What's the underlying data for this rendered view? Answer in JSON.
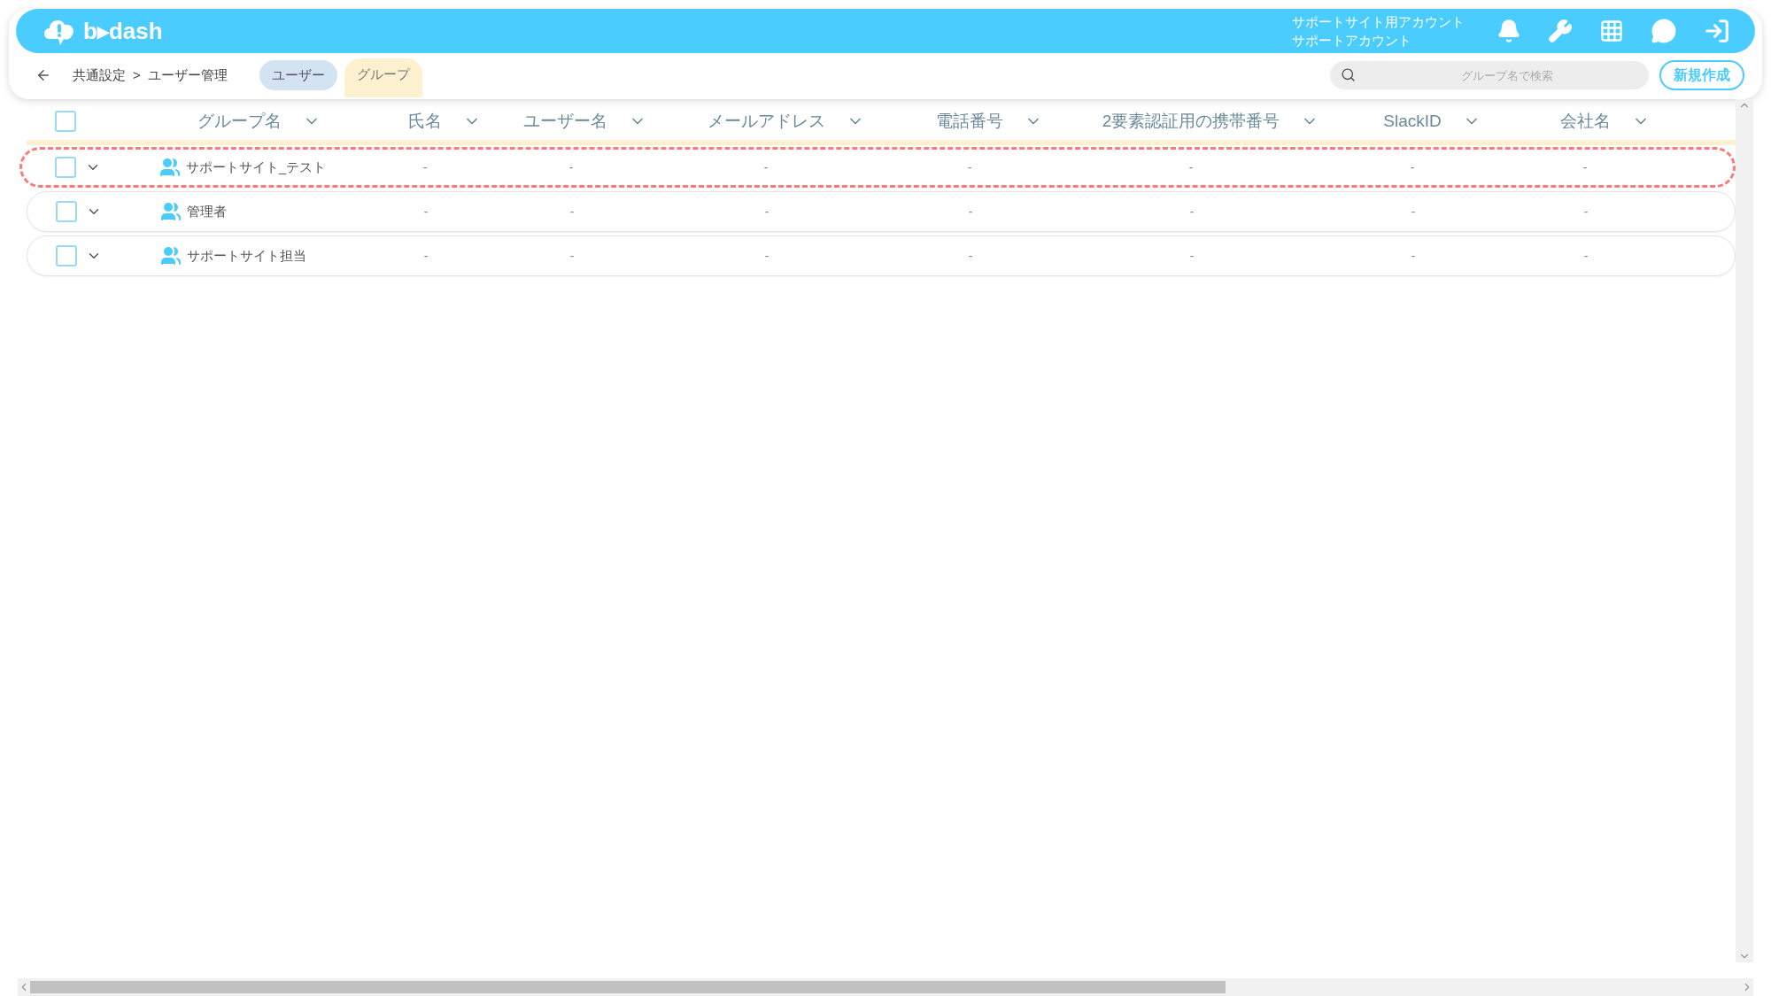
{
  "header": {
    "logo_text": "b▸dash",
    "account_name": "サポートサイト用アカウント",
    "account_sub": "サポートアカウント"
  },
  "toolbar": {
    "breadcrumb": [
      "共通設定",
      ">",
      "ユーザー管理"
    ],
    "tabs": [
      {
        "label": "ユーザー",
        "selected": false
      },
      {
        "label": "グループ",
        "selected": true
      }
    ],
    "search": {
      "placeholder": "グループ名で検索"
    },
    "create_button": "新規作成"
  },
  "table": {
    "select_all_checked": false,
    "columns": [
      "グループ名",
      "氏名",
      "ユーザー名",
      "メールアドレス",
      "電話番号",
      "2要素認証用の携帯番号",
      "SlackID",
      "会社名"
    ],
    "rows": [
      {
        "checked": false,
        "highlighted": true,
        "cells": [
          "サポートサイト_テスト",
          "-",
          "-",
          "-",
          "-",
          "-",
          "-",
          "-"
        ]
      },
      {
        "checked": false,
        "highlighted": false,
        "cells": [
          "管理者",
          "-",
          "-",
          "-",
          "-",
          "-",
          "-",
          "-"
        ]
      },
      {
        "checked": false,
        "highlighted": false,
        "cells": [
          "サポートサイト担当",
          "-",
          "-",
          "-",
          "-",
          "-",
          "-",
          "-"
        ]
      }
    ]
  }
}
